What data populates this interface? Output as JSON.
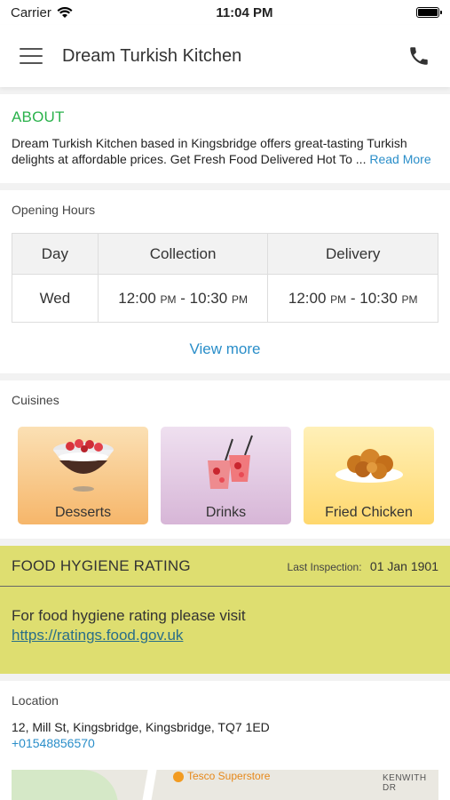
{
  "status_bar": {
    "carrier": "Carrier",
    "time": "11:04 PM"
  },
  "app_bar": {
    "title": "Dream Turkish Kitchen",
    "menu_icon": "hamburger-menu-icon",
    "phone_icon": "phone-icon"
  },
  "about": {
    "title": "ABOUT",
    "text": "Dream Turkish Kitchen based in Kingsbridge offers great-tasting Turkish delights at affordable prices. Get Fresh Food Delivered Hot To ...",
    "read_more": "Read More"
  },
  "opening_hours": {
    "label": "Opening Hours",
    "columns": [
      "Day",
      "Collection",
      "Delivery"
    ],
    "rows": [
      {
        "day": "Wed",
        "collection_start": "12:00",
        "collection_end": "10:30",
        "delivery_start": "12:00",
        "delivery_end": "10:30",
        "pm": "PM",
        "sep": " - "
      }
    ],
    "view_more": "View more"
  },
  "cuisines": {
    "label": "Cuisines",
    "items": [
      {
        "label": "Desserts",
        "icon": "dessert-bowl-icon"
      },
      {
        "label": "Drinks",
        "icon": "drinks-glasses-icon"
      },
      {
        "label": "Fried Chicken",
        "icon": "fried-chicken-icon"
      }
    ]
  },
  "hygiene": {
    "title": "FOOD HYGIENE RATING",
    "inspection_label": "Last Inspection:",
    "inspection_date": "01 Jan 1901",
    "text": "For food hygiene rating please visit",
    "link": "https://ratings.food.gov.uk",
    "color": "#dede70"
  },
  "location": {
    "label": "Location",
    "address": "12, Mill St, Kingsbridge, Kingsbridge, TQ7 1ED",
    "phone": "+01548856570",
    "map_store": "Tesco Superstore",
    "map_street": "KENWITH DR"
  }
}
